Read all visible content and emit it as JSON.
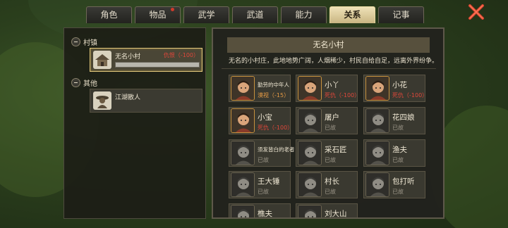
{
  "tabs": [
    {
      "label": "角色",
      "active": false,
      "badge": false
    },
    {
      "label": "物品",
      "active": false,
      "badge": true
    },
    {
      "label": "武学",
      "active": false,
      "badge": false
    },
    {
      "label": "武道",
      "active": false,
      "badge": false
    },
    {
      "label": "能力",
      "active": false,
      "badge": false
    },
    {
      "label": "关系",
      "active": true,
      "badge": false
    },
    {
      "label": "记事",
      "active": false,
      "badge": false
    }
  ],
  "close_icon": "close-x-icon",
  "left": {
    "groups": [
      {
        "label": "村镇",
        "items": [
          {
            "name": "无名小村",
            "status": "仇恨（-100）",
            "selected": true,
            "icon": "village-icon"
          }
        ]
      },
      {
        "label": "其他",
        "items": [
          {
            "name": "江湖散人",
            "status": "",
            "selected": false,
            "icon": "wanderer-icon"
          }
        ]
      }
    ]
  },
  "detail": {
    "title": "无名小村",
    "description": "无名的小村庄，此地地势广阔，人烟稀少，村民自给自足，远离外界纷争。",
    "npcs": [
      {
        "name": "勤劳的中年人",
        "status": "漠视（-15）",
        "tone": "warn",
        "alive": true,
        "small": true
      },
      {
        "name": "小丫",
        "status": "死仇（-100）",
        "tone": "hostile",
        "alive": true,
        "small": false
      },
      {
        "name": "小花",
        "status": "死仇（-100）",
        "tone": "hostile",
        "alive": true,
        "small": false
      },
      {
        "name": "小宝",
        "status": "死仇（-100）",
        "tone": "hostile",
        "alive": true,
        "small": false
      },
      {
        "name": "屠户",
        "status": "已故",
        "tone": "dead",
        "alive": false,
        "small": false
      },
      {
        "name": "花四娘",
        "status": "已故",
        "tone": "dead",
        "alive": false,
        "small": false
      },
      {
        "name": "须发皆白的老者",
        "status": "已故",
        "tone": "dead",
        "alive": false,
        "small": true
      },
      {
        "name": "采石匠",
        "status": "已故",
        "tone": "dead",
        "alive": false,
        "small": false
      },
      {
        "name": "渔夫",
        "status": "已故",
        "tone": "dead",
        "alive": false,
        "small": false
      },
      {
        "name": "王大锤",
        "status": "已故",
        "tone": "dead",
        "alive": false,
        "small": false
      },
      {
        "name": "村长",
        "status": "已故",
        "tone": "dead",
        "alive": false,
        "small": false
      },
      {
        "name": "包打听",
        "status": "已故",
        "tone": "dead",
        "alive": false,
        "small": false
      },
      {
        "name": "樵夫",
        "status": "",
        "tone": "dead",
        "alive": false,
        "small": false
      },
      {
        "name": "刘大山",
        "status": "",
        "tone": "dead",
        "alive": false,
        "small": false
      }
    ]
  },
  "colors": {
    "hostile": "#e0473a",
    "warn": "#e59a45",
    "dead": "#9b9587",
    "accent": "#e2c87c"
  }
}
